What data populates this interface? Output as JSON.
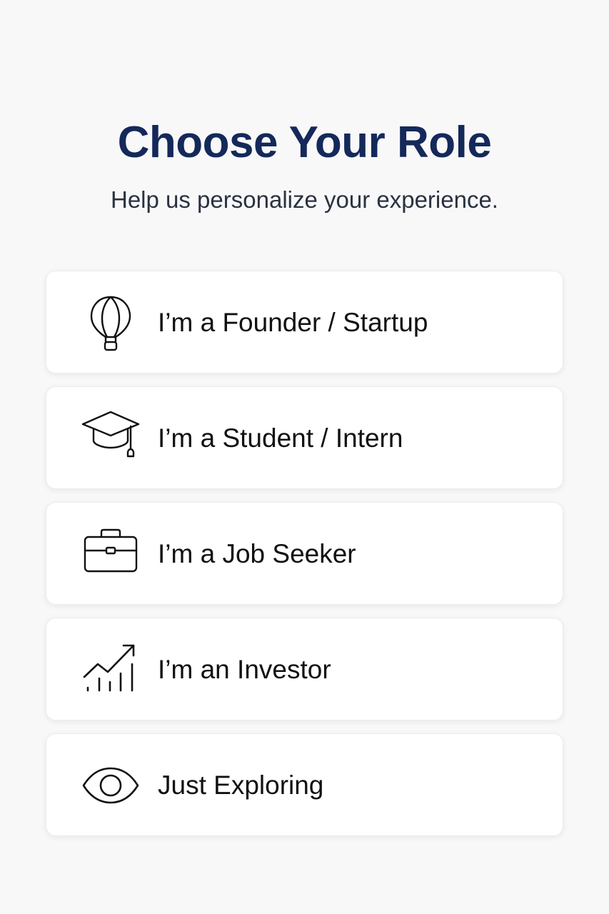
{
  "header": {
    "title": "Choose Your Role",
    "subtitle": "Help us personalize your experience."
  },
  "roles": [
    {
      "label": "I’m a Founder / Startup",
      "icon": "hot-air-balloon-icon"
    },
    {
      "label": "I’m a Student / Intern",
      "icon": "graduation-cap-icon"
    },
    {
      "label": "I’m a Job Seeker",
      "icon": "briefcase-icon"
    },
    {
      "label": "I’m an Investor",
      "icon": "growth-chart-icon"
    },
    {
      "label": "Just Exploring",
      "icon": "eye-icon"
    }
  ],
  "colors": {
    "title": "#14295a",
    "subtitle": "#2a3240",
    "background": "#f8f8f9",
    "card": "#ffffff",
    "icon_stroke": "#111111"
  }
}
